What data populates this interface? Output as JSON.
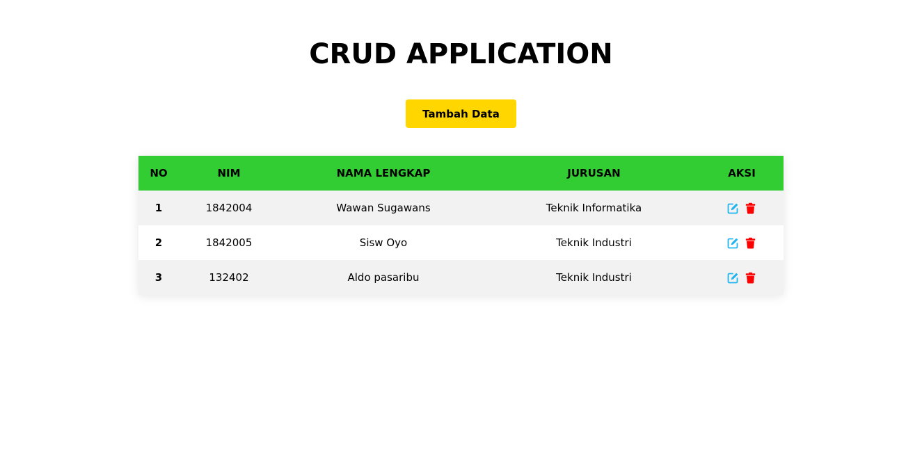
{
  "title": "CRUD APPLICATION",
  "add_button": {
    "label": "Tambah Data",
    "color": "#ffd600"
  },
  "table": {
    "header_color": "#32cd32",
    "columns": [
      "NO",
      "NIM",
      "NAMA LENGKAP",
      "JURUSAN",
      "AKSI"
    ],
    "rows": [
      {
        "no": "1",
        "nim": "1842004",
        "nama": "Wawan Sugawans",
        "jurusan": "Teknik Informatika"
      },
      {
        "no": "2",
        "nim": "1842005",
        "nama": "Sisw Oyo",
        "jurusan": "Teknik Industri"
      },
      {
        "no": "3",
        "nim": "132402",
        "nama": "Aldo pasaribu",
        "jurusan": "Teknik Industri"
      }
    ],
    "actions": {
      "edit_icon": "edit-icon",
      "edit_color": "#1eb4f0",
      "delete_icon": "trash-icon",
      "delete_color": "#ff0000"
    }
  }
}
